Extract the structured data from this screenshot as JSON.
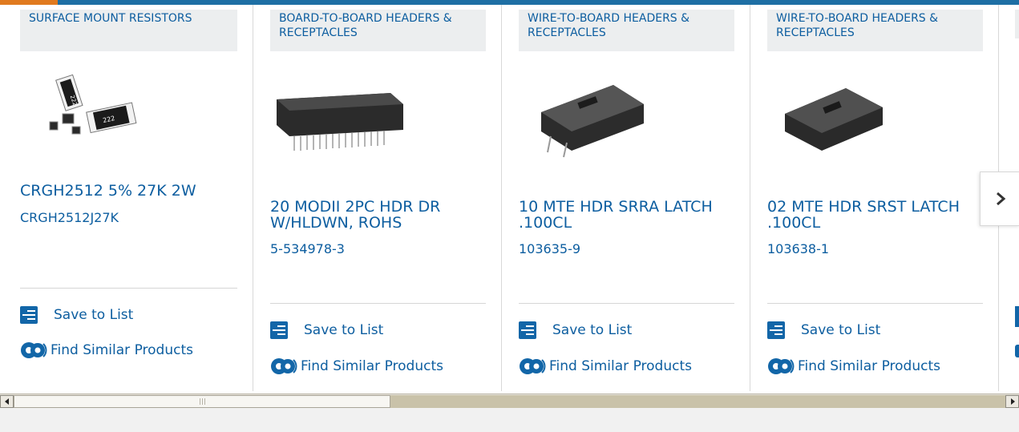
{
  "colors": {
    "link": "#0d5ea0",
    "header_bar": "#1e6fa4",
    "header_accent": "#e07a1f",
    "category_bg": "#eceeef"
  },
  "products": [
    {
      "category": "SURFACE MOUNT RESISTORS",
      "title": "CRGH2512 5% 27K 2W",
      "part_number": "CRGH2512J27K",
      "save_label": "Save to List",
      "similar_label": "Find Similar Products"
    },
    {
      "category": "BOARD-TO-BOARD HEADERS & RECEPTACLES",
      "title": "20 MODII 2PC HDR DR W/HLDWN, ROHS",
      "part_number": "5-534978-3",
      "save_label": "Save to List",
      "similar_label": "Find Similar Products"
    },
    {
      "category": "WIRE-TO-BOARD HEADERS & RECEPTACLES",
      "title": "10 MTE HDR SRRA LATCH .100CL",
      "part_number": "103635-9",
      "save_label": "Save to List",
      "similar_label": "Find Similar Products"
    },
    {
      "category": "WIRE-TO-BOARD HEADERS & RECEPTACLES",
      "title": "02 MTE HDR SRST LATCH .100CL",
      "part_number": "103638-1",
      "save_label": "Save to List",
      "similar_label": "Find Similar Products"
    }
  ],
  "carousel": {
    "next_icon": "chevron-right-icon"
  },
  "scrollbar": {
    "left_icon": "arrow-left-icon",
    "right_icon": "arrow-right-icon"
  }
}
